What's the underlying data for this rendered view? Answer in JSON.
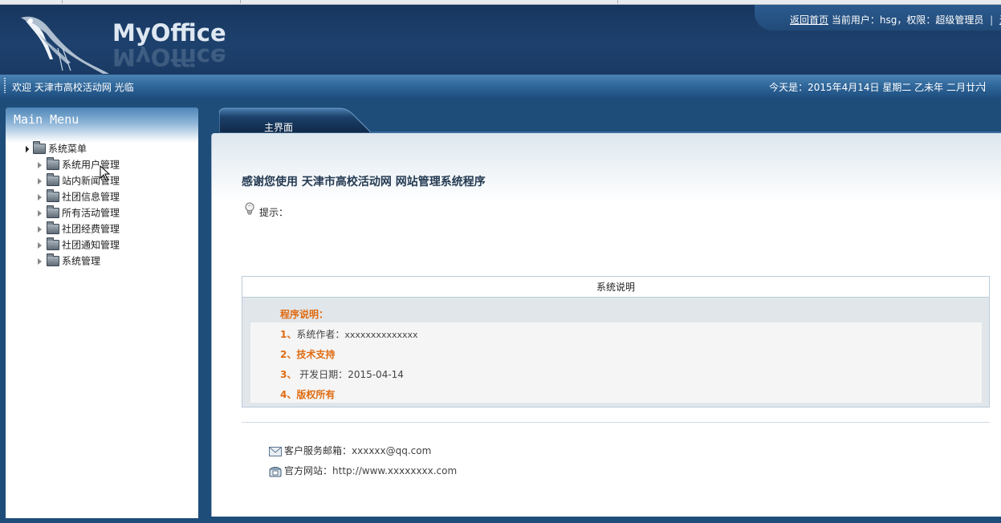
{
  "header": {
    "logo_text": "MyOffice",
    "home_link": "返回首页",
    "current_user_text": "当前用户：hsg，权限：超级管理员",
    "separator": "|",
    "logout_partial": "退"
  },
  "welcome_bar": {
    "welcome_text": "欢迎 天津市高校活动网 光临",
    "date_text": "今天是：2015年4月14日 星期二 乙未年 二月廿六"
  },
  "sidebar": {
    "title": "Main Menu",
    "root": "系统菜单",
    "items": [
      {
        "label": "系统用户管理"
      },
      {
        "label": "站内新闻管理"
      },
      {
        "label": "社团信息管理"
      },
      {
        "label": "所有活动管理"
      },
      {
        "label": "社团经费管理"
      },
      {
        "label": "社团通知管理"
      },
      {
        "label": "系统管理"
      }
    ]
  },
  "main": {
    "tab_label": "主界面",
    "title": "感谢您使用 天津市高校活动网 网站管理系统程序",
    "hint_label": "提示：",
    "info": {
      "header": "系统说明",
      "section_title": "程序说明：",
      "items": [
        {
          "num": "1、",
          "label": "系统作者：",
          "value": "xxxxxxxxxxxxxx"
        },
        {
          "num": "2、",
          "label": "技术支持"
        },
        {
          "num": "3、",
          "label": " 开发日期：",
          "value": "2015-04-14"
        },
        {
          "num": "4、",
          "label": "版权所有"
        }
      ]
    },
    "contact": {
      "email_label": "客户服务邮箱：",
      "email_value": "xxxxxx@qq.com",
      "website_label": "官方网站：",
      "website_value": "http://www.xxxxxxxx.com"
    }
  },
  "colors": {
    "header_bg": "#1b3d68",
    "accent_orange": "#e06b10",
    "welcome_bar": "#2f6699"
  },
  "icons": {
    "logo": "bird-logo-icon",
    "folder": "folder-icon",
    "hint": "lightbulb-icon",
    "email": "envelope-icon",
    "website": "telephone-icon",
    "cursor": "mouse-cursor-icon"
  }
}
